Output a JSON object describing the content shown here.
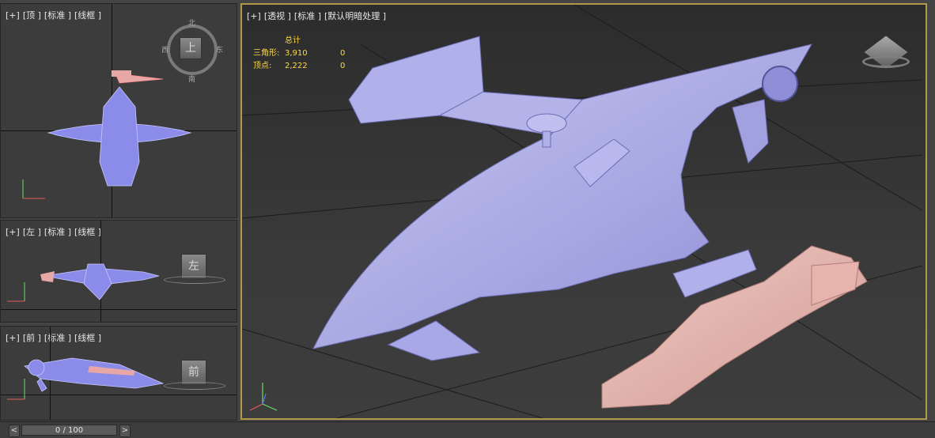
{
  "viewports": {
    "top": {
      "labels": [
        "[+]",
        "[顶 ]",
        "[标准 ]",
        "[线框 ]"
      ],
      "compass": {
        "north": "北",
        "south": "南",
        "east": "东",
        "west": "西",
        "cube": "上"
      }
    },
    "left": {
      "labels": [
        "[+]",
        "[左 ]",
        "[标准 ]",
        "[线框 ]"
      ],
      "cube": "左"
    },
    "front": {
      "labels": [
        "[+]",
        "[前 ]",
        "[标准 ]",
        "[线框 ]"
      ],
      "cube": "前"
    },
    "perspective": {
      "labels": [
        "[+]",
        "[透视 ]",
        "[标准 ]",
        "[默认明暗处理 ]"
      ]
    }
  },
  "stats": {
    "header": "总计",
    "rows": [
      {
        "label": "三角形:",
        "total": "3,910",
        "selected": "0"
      },
      {
        "label": "顶点:",
        "total": "2,222",
        "selected": "0"
      }
    ]
  },
  "timeline": {
    "frame": "0 / 100",
    "prev": "<",
    "next": ">"
  },
  "colors": {
    "model": "#a7a7e8",
    "weapon": "#e8b4ae",
    "selected_border": "#b09a48"
  }
}
